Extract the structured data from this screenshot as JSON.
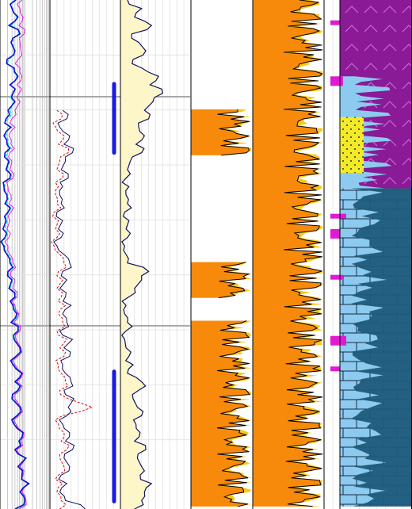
{
  "colors": {
    "resistivity_deep": "#1010d0",
    "resistivity_medium": "#e020e0",
    "resistivity_shallow": "#20d8d8",
    "density": "#d01010",
    "neutron": "#101060",
    "gamma_ray": "#101060",
    "gamma_fill": "#fdf6c8",
    "marker_bar": "#1a1ae6",
    "porosity_fill_dark": "#f78a0a",
    "porosity_fill_light": "#f8c81a",
    "lithology_purple": "#8a1a96",
    "lithology_dark_teal": "#1f5a7a",
    "lithology_light_blue": "#8ccaf0",
    "lithology_yellow": "#f2ea28",
    "lithology_magenta": "#e01ad0",
    "grid_major": "#a8a8a8",
    "grid_minor": "#e0e0e0",
    "track_border": "#000000"
  },
  "chart_data": {
    "type": "well-log",
    "depth_range": [
      0,
      1
    ],
    "depth_ticks": [
      0.19,
      0.64
    ],
    "tracks": [
      {
        "id": "resistivity",
        "scale": "log",
        "series": [
          "deep",
          "medium",
          "shallow"
        ],
        "curves": {
          "deep": [
            0.32,
            0.24,
            0.36,
            0.18,
            0.4,
            0.22,
            0.3,
            0.14,
            0.28,
            0.36,
            0.2,
            0.26,
            0.3,
            0.16,
            0.12,
            0.22,
            0.08,
            0.14,
            0.1,
            0.18,
            0.12,
            0.2,
            0.08,
            0.14,
            0.1,
            0.16,
            0.12,
            0.06,
            0.1,
            0.08,
            0.14,
            0.2,
            0.16,
            0.24,
            0.18,
            0.3,
            0.26,
            0.34,
            0.22,
            0.36,
            0.28,
            0.4,
            0.32,
            0.26,
            0.44,
            0.3,
            0.36,
            0.24,
            0.4,
            0.34,
            0.28,
            0.46,
            0.38,
            0.3,
            0.52,
            0.36,
            0.44,
            0.58,
            0.4,
            0.5,
            0.3
          ],
          "medium": [
            0.44,
            0.4,
            0.46,
            0.38,
            0.48,
            0.4,
            0.42,
            0.36,
            0.4,
            0.44,
            0.34,
            0.38,
            0.4,
            0.3,
            0.24,
            0.3,
            0.18,
            0.22,
            0.2,
            0.24,
            0.2,
            0.26,
            0.16,
            0.22,
            0.18,
            0.22,
            0.2,
            0.14,
            0.18,
            0.16,
            0.2,
            0.26,
            0.22,
            0.3,
            0.26,
            0.34,
            0.3,
            0.38,
            0.28,
            0.4,
            0.32,
            0.42,
            0.36,
            0.3,
            0.46,
            0.34,
            0.4,
            0.3,
            0.42,
            0.38,
            0.32,
            0.48,
            0.42,
            0.34,
            0.52,
            0.4,
            0.46,
            0.56,
            0.44,
            0.52,
            0.38
          ],
          "shallow": [
            0.3,
            0.26,
            0.34,
            0.22,
            0.38,
            0.26,
            0.28,
            0.18,
            0.26,
            0.34,
            0.22,
            0.24,
            0.28,
            0.2,
            0.16,
            0.2,
            0.12,
            0.16,
            0.14,
            0.2,
            0.14,
            0.22,
            0.1,
            0.16,
            0.12,
            0.18,
            0.14,
            0.1,
            0.12,
            0.1,
            0.16,
            0.22,
            0.18,
            0.26,
            0.2,
            0.32,
            0.28,
            0.36,
            0.24,
            0.38,
            0.3,
            0.4,
            0.34,
            0.28,
            0.44,
            0.32,
            0.38,
            0.26,
            0.42,
            0.36,
            0.3,
            0.46,
            0.4,
            0.32,
            0.5,
            0.38,
            0.44,
            0.56,
            0.42,
            0.5,
            0.34
          ]
        }
      },
      {
        "id": "density_neutron",
        "series": [
          "density",
          "neutron"
        ],
        "curves": {
          "density": [
            null,
            null,
            null,
            null,
            null,
            null,
            null,
            null,
            null,
            null,
            null,
            null,
            null,
            0.1,
            0.16,
            0.08,
            0.2,
            0.12,
            0.26,
            0.14,
            0.1,
            0.18,
            0.12,
            0.08,
            0.1,
            0.06,
            0.12,
            0.08,
            0.1,
            0.06,
            0.14,
            0.2,
            0.12,
            0.18,
            0.1,
            0.16,
            0.22,
            0.12,
            0.18,
            0.1,
            0.24,
            0.14,
            0.2,
            0.12,
            0.16,
            0.22,
            0.14,
            0.26,
            0.6,
            0.18,
            0.12,
            0.2,
            0.16,
            0.24,
            0.14,
            0.2,
            0.12,
            0.18,
            0.1,
            0.16,
            0.14
          ],
          "neutron": [
            null,
            null,
            null,
            null,
            null,
            null,
            null,
            null,
            null,
            null,
            null,
            null,
            null,
            0.18,
            0.24,
            0.14,
            0.28,
            0.2,
            0.32,
            0.22,
            0.16,
            0.26,
            0.18,
            0.14,
            0.16,
            0.1,
            0.18,
            0.12,
            0.16,
            0.1,
            0.2,
            0.28,
            0.18,
            0.24,
            0.14,
            0.22,
            0.3,
            0.18,
            0.24,
            0.14,
            0.32,
            0.2,
            0.28,
            0.18,
            0.22,
            0.3,
            0.2,
            0.34,
            0.26,
            0.24,
            0.18,
            0.28,
            0.22,
            0.32,
            0.2,
            0.28,
            0.16,
            0.24,
            0.14,
            0.22,
            0.5
          ]
        }
      },
      {
        "id": "gamma_ray",
        "series": [
          "gamma_ray"
        ],
        "curves": {
          "gamma_ray": [
            0.1,
            0.3,
            0.2,
            0.44,
            0.16,
            0.26,
            0.36,
            0.18,
            0.3,
            0.54,
            0.42,
            0.6,
            0.46,
            0.34,
            0.4,
            0.26,
            0.34,
            0.22,
            0.3,
            0.14,
            0.1,
            0.08,
            0.12,
            0.08,
            0.1,
            0.06,
            0.12,
            0.08,
            0.1,
            0.06,
            0.08,
            0.1,
            0.4,
            0.3,
            0.2,
            0.12,
            0.08,
            0.06,
            0.1,
            0.08,
            0.06,
            0.08,
            0.12,
            0.18,
            0.1,
            0.3,
            0.26,
            0.18,
            0.24,
            0.3,
            0.22,
            0.28,
            0.2,
            0.36,
            0.24,
            0.3,
            0.28,
            0.44,
            0.34,
            0.3,
            0.2
          ]
        },
        "markers": [
          [
            0.165,
            0.3
          ],
          [
            0.73,
            0.985
          ]
        ]
      },
      {
        "id": "porosity_a",
        "fill": [
          "porosity_fill_dark",
          "porosity_fill_light"
        ],
        "intervals": [
          [
            0.215,
            0.305
          ],
          [
            0.515,
            0.585
          ],
          [
            0.63,
            0.995
          ]
        ]
      },
      {
        "id": "porosity_b",
        "fill": [
          "porosity_fill_dark",
          "porosity_fill_light"
        ],
        "intervals": [
          [
            0.0,
            0.995
          ]
        ]
      },
      {
        "id": "lithology",
        "zones": [
          {
            "range": [
              0.0,
              0.155
            ],
            "lith": "lithology_purple"
          },
          {
            "range": [
              0.155,
              0.37
            ],
            "lith": "lithology_purple"
          },
          {
            "range": [
              0.37,
              0.995
            ],
            "lith": "lithology_light_blue"
          }
        ]
      }
    ]
  }
}
